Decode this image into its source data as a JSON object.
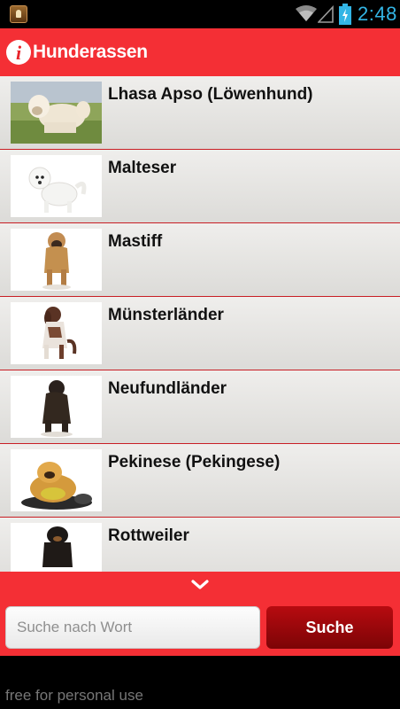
{
  "status_bar": {
    "time": "2:48",
    "icons": [
      "app-icon",
      "wifi-icon",
      "signal-icon",
      "battery-charging-icon"
    ]
  },
  "header": {
    "title": "Hunderassen",
    "icon": "info-icon"
  },
  "list": {
    "items": [
      {
        "label": "",
        "thumb": "dog-partial"
      },
      {
        "label": "Lhasa Apso (Löwenhund)",
        "thumb": "lhasa-apso"
      },
      {
        "label": "Malteser",
        "thumb": "maltese"
      },
      {
        "label": "Mastiff",
        "thumb": "mastiff"
      },
      {
        "label": "Münsterländer",
        "thumb": "munsterlander"
      },
      {
        "label": "Neufundländer",
        "thumb": "newfoundland"
      },
      {
        "label": "Pekinese (Pekingese)",
        "thumb": "pekingese"
      },
      {
        "label": "Rottweiler",
        "thumb": "rottweiler"
      }
    ]
  },
  "search": {
    "placeholder": "Suche nach Wort",
    "value": "",
    "button_label": "Suche",
    "expand_icon": "chevron-down-icon"
  },
  "footer": {
    "text": "free for personal use"
  },
  "colors": {
    "accent": "#f42f35",
    "button": "#9a080c",
    "time": "#33b5e5"
  }
}
